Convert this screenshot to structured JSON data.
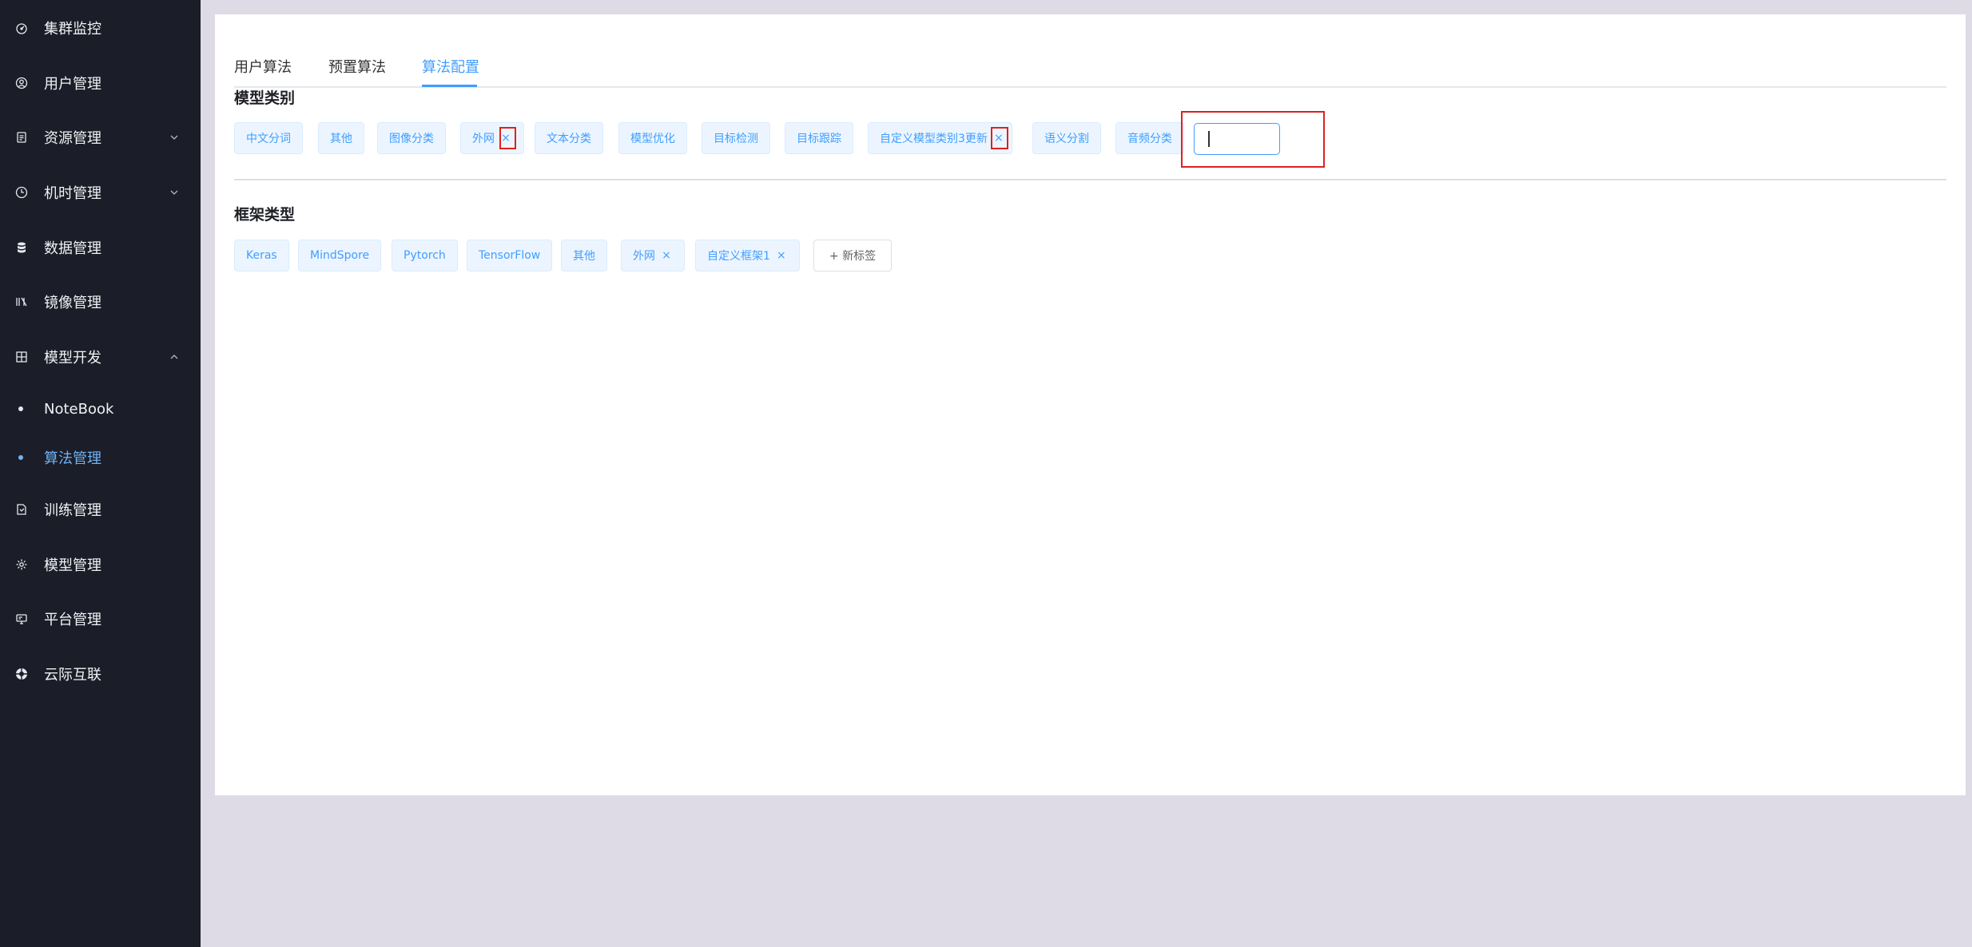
{
  "sidebar": {
    "items": [
      {
        "label": "集群监控",
        "icon": "dashboard-icon"
      },
      {
        "label": "用户管理",
        "icon": "user-icon"
      },
      {
        "label": "资源管理",
        "icon": "document-icon",
        "expandable": true
      },
      {
        "label": "机时管理",
        "icon": "clock-icon",
        "expandable": true
      },
      {
        "label": "数据管理",
        "icon": "database-icon"
      },
      {
        "label": "镜像管理",
        "icon": "image-icon"
      },
      {
        "label": "模型开发",
        "icon": "grid-icon",
        "expanded": true
      },
      {
        "label": "训练管理",
        "icon": "file-icon"
      },
      {
        "label": "模型管理",
        "icon": "settings-icon"
      },
      {
        "label": "平台管理",
        "icon": "monitor-icon"
      },
      {
        "label": "云际互联",
        "icon": "globe-icon"
      }
    ],
    "sub_items": [
      {
        "label": "NoteBook"
      },
      {
        "label": "算法管理",
        "active": true
      }
    ]
  },
  "tabs": [
    {
      "label": "用户算法"
    },
    {
      "label": "预置算法"
    },
    {
      "label": "算法配置",
      "active": true
    }
  ],
  "model_category": {
    "title": "模型类别",
    "tags": [
      {
        "label": "中文分词",
        "closable": false
      },
      {
        "label": "其他",
        "closable": false
      },
      {
        "label": "图像分类",
        "closable": false
      },
      {
        "label": "外网",
        "closable": true
      },
      {
        "label": "文本分类",
        "closable": false
      },
      {
        "label": "模型优化",
        "closable": false
      },
      {
        "label": "目标检测",
        "closable": false
      },
      {
        "label": "目标跟踪",
        "closable": false
      },
      {
        "label": "自定义模型类别3更新",
        "closable": true
      },
      {
        "label": "语义分割",
        "closable": false
      },
      {
        "label": "音频分类",
        "closable": false
      }
    ],
    "input_value": ""
  },
  "framework_type": {
    "title": "框架类型",
    "tags": [
      {
        "label": "Keras",
        "closable": false
      },
      {
        "label": "MindSpore",
        "closable": false
      },
      {
        "label": "Pytorch",
        "closable": false
      },
      {
        "label": "TensorFlow",
        "closable": false
      },
      {
        "label": "其他",
        "closable": false
      },
      {
        "label": "外网",
        "closable": true
      },
      {
        "label": "自定义框架1",
        "closable": true
      }
    ],
    "new_tag_label": "+ 新标签"
  },
  "close_glyph": "×",
  "colors": {
    "sidebar_bg": "#1b1d28",
    "accent": "#409eff",
    "highlight": "#e02020",
    "page_bg": "#dedbe6"
  }
}
